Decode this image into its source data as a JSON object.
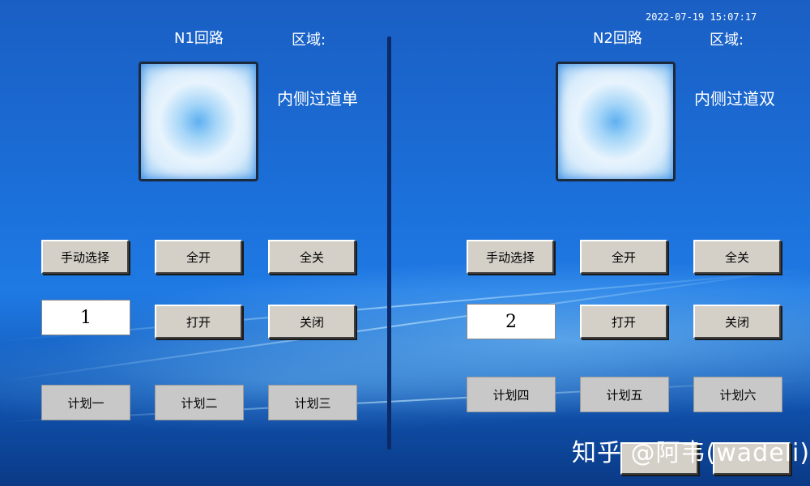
{
  "header": {
    "datetime": "2022-07-19  15:07:17"
  },
  "left_panel": {
    "circuit_label": "N1回路",
    "area_label": "区域:",
    "area_name": "内侧过道单",
    "manual_select": "手动选择",
    "all_on": "全开",
    "all_off": "全关",
    "number": "1",
    "open": "打开",
    "close": "关闭",
    "plans": [
      "计划一",
      "计划二",
      "计划三"
    ]
  },
  "right_panel": {
    "circuit_label": "N2回路",
    "area_label": "区域:",
    "area_name": "内侧过道双",
    "manual_select": "手动选择",
    "all_on": "全开",
    "all_off": "全关",
    "number": "2",
    "open": "打开",
    "close": "关闭",
    "plans": [
      "计划四",
      "计划五",
      "计划六"
    ]
  },
  "watermark": "知乎 @阿韦(wadeli)",
  "colors": {
    "background": "#1b6dd6",
    "divider": "#0c2a66",
    "button_face": "#d4d0c8",
    "plan_face": "#c8c8c8"
  }
}
